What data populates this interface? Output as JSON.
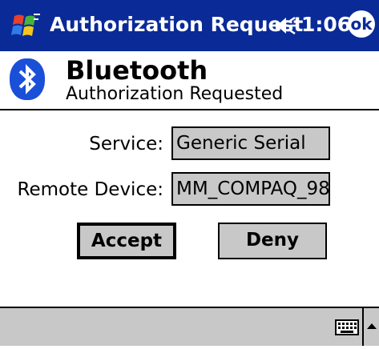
{
  "title_bar": {
    "app_title": "Authorization Request",
    "clock": "1:06",
    "ok_label": "ok",
    "start_icon": "windows-flag-icon",
    "speaker_icon": "speaker-icon"
  },
  "header": {
    "title": "Bluetooth",
    "subtitle": "Authorization Requested",
    "logo_icon": "bluetooth-icon"
  },
  "form": {
    "service_label": "Service:",
    "service_value": "Generic Serial",
    "remote_device_label": "Remote Device:",
    "remote_device_value": "MM_COMPAQ_98"
  },
  "buttons": {
    "accept": "Accept",
    "deny": "Deny"
  },
  "taskbar": {
    "keyboard_icon": "keyboard-icon",
    "input_arrow_icon": "up-arrow-icon"
  },
  "colors": {
    "title_bar": "#0a2a98",
    "control_gray": "#c8c8c8",
    "bluetooth_blue": "#1a4fd8"
  }
}
